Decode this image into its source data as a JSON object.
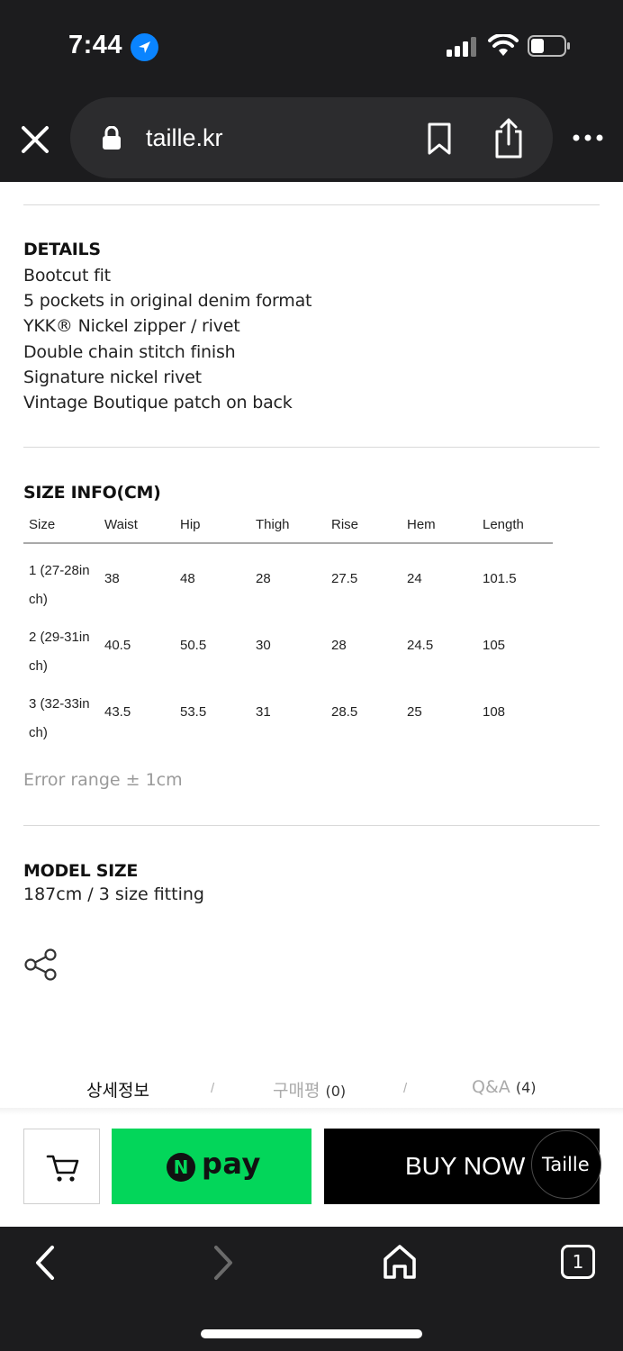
{
  "status_bar": {
    "time": "7:44"
  },
  "browser": {
    "url": "taille.kr"
  },
  "details": {
    "title": "DETAILS",
    "items": [
      "Bootcut fit",
      "5 pockets in original denim format",
      "YKK® Nickel zipper / rivet",
      "Double chain stitch finish",
      "Signature nickel rivet",
      "Vintage Boutique patch on back"
    ]
  },
  "size_info": {
    "title": "SIZE INFO(CM)",
    "headers": [
      "Size",
      "Waist",
      "Hip",
      "Thigh",
      "Rise",
      "Hem",
      "Length"
    ],
    "rows": [
      [
        "1 (27-28in ch)",
        "38",
        "48",
        "28",
        "27.5",
        "24",
        "101.5"
      ],
      [
        "2 (29-31in ch)",
        "40.5",
        "50.5",
        "30",
        "28",
        "24.5",
        "105"
      ],
      [
        "3 (32-33in ch)",
        "43.5",
        "53.5",
        "31",
        "28.5",
        "25",
        "108"
      ]
    ],
    "error_note": "Error range ± 1cm"
  },
  "model": {
    "title": "MODEL SIZE",
    "text": "187cm / 3 size fitting"
  },
  "tabs": {
    "detail": "상세정보",
    "review_label": "구매평",
    "review_count": "(0)",
    "qa_label": "Q&A",
    "qa_count": "(4)",
    "separator": "/"
  },
  "actions": {
    "npay_mark": "N",
    "npay_label": "pay",
    "buy_now": "BUY NOW",
    "chat_label": "Taille"
  },
  "bottom_nav": {
    "tab_count": "1"
  },
  "colors": {
    "chrome": "#1c1c1e",
    "npay_green": "#03d65a",
    "buy_black": "#000000",
    "location_blue": "#0a84ff"
  }
}
